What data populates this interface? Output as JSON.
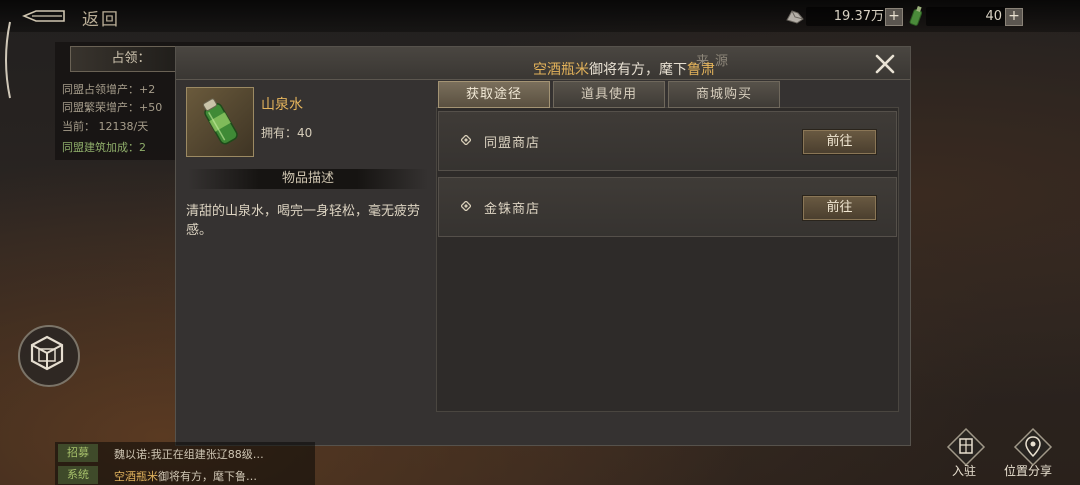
{
  "topbar": {
    "back_label": "返回",
    "resource1_value": "19.37万",
    "resource2_value": "40",
    "plus_symbol": "+"
  },
  "side_panel": {
    "title": "占领：",
    "lines": [
      "同盟占领增产：+2",
      "同盟繁荣增产：+50",
      "当前： 12138/天",
      "同盟建筑加成：2"
    ]
  },
  "modal": {
    "title_ghost": "来源",
    "ticker_prefix": "空酒瓶米",
    "ticker_rest": "御将有方，麾下",
    "ticker_name": "鲁肃",
    "item": {
      "name": "山泉水",
      "owned": "拥有：40"
    },
    "desc_header": "物品描述",
    "desc_text": "清甜的山泉水，喝完一身轻松，毫无疲劳感。",
    "tabs": [
      "获取途径",
      "道具使用",
      "商城购买"
    ],
    "active_tab": 0,
    "sources": [
      {
        "label": "同盟商店",
        "button": "前往"
      },
      {
        "label": "金铢商店",
        "button": "前往"
      }
    ]
  },
  "chat": [
    {
      "tag": "招募",
      "text": "魏以诺:我正在组建张辽88级…"
    },
    {
      "tag": "系统",
      "text_hl": "空酒瓶米",
      "text": "御将有方，麾下鲁…"
    }
  ],
  "corner": {
    "join_label": "入驻",
    "share_label": "位置分享"
  },
  "colors": {
    "gold": "#e2b25a",
    "tab_active": "#7a6f5c",
    "panel_bg": "#353231"
  }
}
